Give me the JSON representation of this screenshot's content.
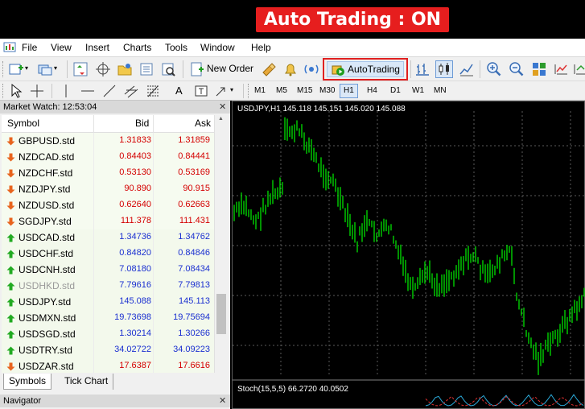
{
  "banner": {
    "label": "Auto Trading : ON"
  },
  "menu": [
    "File",
    "View",
    "Insert",
    "Charts",
    "Tools",
    "Window",
    "Help"
  ],
  "toolbar": {
    "new_order_label": "New Order",
    "autotrading_label": "AutoTrading",
    "timeframes": [
      "M1",
      "M5",
      "M15",
      "M30",
      "H1",
      "H4",
      "D1",
      "W1",
      "MN"
    ]
  },
  "market_watch": {
    "title": "Market Watch: 12:53:04",
    "columns": {
      "symbol": "Symbol",
      "bid": "Bid",
      "ask": "Ask"
    },
    "rows": [
      {
        "symbol": "GBPUSD.std",
        "bid": "1.31833",
        "ask": "1.31859",
        "dir": "down"
      },
      {
        "symbol": "NZDCAD.std",
        "bid": "0.84403",
        "ask": "0.84441",
        "dir": "down"
      },
      {
        "symbol": "NZDCHF.std",
        "bid": "0.53130",
        "ask": "0.53169",
        "dir": "down"
      },
      {
        "symbol": "NZDJPY.std",
        "bid": "90.890",
        "ask": "90.915",
        "dir": "down"
      },
      {
        "symbol": "NZDUSD.std",
        "bid": "0.62640",
        "ask": "0.62663",
        "dir": "down"
      },
      {
        "symbol": "SGDJPY.std",
        "bid": "111.378",
        "ask": "111.431",
        "dir": "down"
      },
      {
        "symbol": "USDCAD.std",
        "bid": "1.34736",
        "ask": "1.34762",
        "dir": "up"
      },
      {
        "symbol": "USDCHF.std",
        "bid": "0.84820",
        "ask": "0.84846",
        "dir": "up"
      },
      {
        "symbol": "USDCNH.std",
        "bid": "7.08180",
        "ask": "7.08434",
        "dir": "up"
      },
      {
        "symbol": "USDHKD.std",
        "bid": "7.79616",
        "ask": "7.79813",
        "dir": "up",
        "muted": true
      },
      {
        "symbol": "USDJPY.std",
        "bid": "145.088",
        "ask": "145.113",
        "dir": "up"
      },
      {
        "symbol": "USDMXN.std",
        "bid": "19.73698",
        "ask": "19.75694",
        "dir": "up"
      },
      {
        "symbol": "USDSGD.std",
        "bid": "1.30214",
        "ask": "1.30266",
        "dir": "up"
      },
      {
        "symbol": "USDTRY.std",
        "bid": "34.02722",
        "ask": "34.09223",
        "dir": "up"
      },
      {
        "symbol": "USDZAR.std",
        "bid": "17.6387",
        "ask": "17.6616",
        "dir": "down"
      }
    ],
    "tabs": [
      "Symbols",
      "Tick Chart"
    ]
  },
  "navigator": {
    "title": "Navigator"
  },
  "chart": {
    "title": "USDJPY,H1  145.118 145.151 145.020 145.088",
    "indicator_label": "Stoch(15,5,5) 66.2720 40.0502",
    "colors": {
      "candle": "#00e000",
      "background": "#000000",
      "grid": "#5a5a5a",
      "stoch_main": "#2aa7d6",
      "stoch_signal": "#e03030"
    }
  },
  "colors": {
    "banner": "#e61e1e",
    "bid_down": "#d40000",
    "bid_up": "#1a2fd0",
    "autotrading_highlight": "#e02020"
  }
}
